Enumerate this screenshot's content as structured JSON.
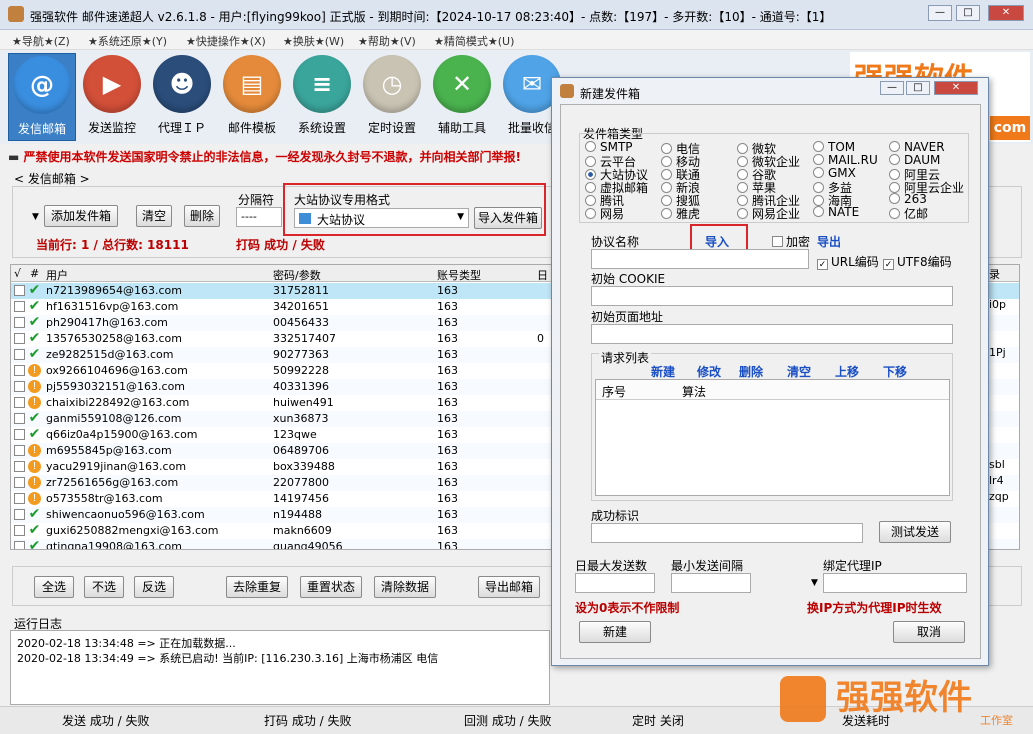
{
  "window": {
    "title": "强强软件 邮件速递超人 v2.6.1.8 - 用户:[flying99koo] 正式版 - 到期时间:【2024-10-17 08:23:40】- 点数:【197】- 多开数:【10】- 通道号:【1】"
  },
  "menu": [
    "★导航★(Z)",
    "★系统还原★(Y)",
    "★快捷操作★(X)",
    "★换肤★(W)",
    "★帮助★(V)",
    "★精简模式★(U)"
  ],
  "toolbar": [
    {
      "label": "发信邮箱",
      "icon": "at-icon",
      "color": "#3a8ee0"
    },
    {
      "label": "发送监控",
      "icon": "play-icon",
      "color": "#d24f38"
    },
    {
      "label": "代理ＩＰ",
      "icon": "user-icon",
      "color": "#2a4d7a"
    },
    {
      "label": "邮件模板",
      "icon": "doc-icon",
      "color": "#e48a3a"
    },
    {
      "label": "系统设置",
      "icon": "sliders-icon",
      "color": "#3aa59b"
    },
    {
      "label": "定时设置",
      "icon": "clock-icon",
      "color": "#c9c3b3"
    },
    {
      "label": "辅助工具",
      "icon": "wrench-icon",
      "color": "#4ab34e"
    },
    {
      "label": "批量收信",
      "icon": "mail-icon",
      "color": "#4fa3e6"
    }
  ],
  "brand": {
    "text": "强强软件",
    "sub": "工作室",
    "domain": "com"
  },
  "warning": "严禁使用本软件发送国家明令禁止的非法信息，一经发现永久封号不退款，并向相关部门举报!",
  "section": "< 发信邮箱 >",
  "controls": {
    "add": "添加发件箱",
    "clear": "清空",
    "delete": "删除",
    "separator_label": "分隔符",
    "separator_value": "----",
    "protocol_title": "大站协议专用格式",
    "protocol_value": "大站协议",
    "import": "导入发件箱",
    "current": "当前行: 1 / 总行数: 18111",
    "captcha": "打码 成功 / 失败"
  },
  "grid": {
    "headers": [
      "√",
      "#",
      "用户",
      "密码/参数",
      "账号类型",
      "日"
    ],
    "rows": [
      {
        "s": "ok",
        "user": "n7213989654@163.com",
        "pwd": "31752811",
        "type": "163",
        "d": ""
      },
      {
        "s": "ok",
        "user": "hf1631516vp@163.com",
        "pwd": "34201651",
        "type": "163",
        "d": ""
      },
      {
        "s": "ok",
        "user": "ph290417h@163.com",
        "pwd": "00456433",
        "type": "163",
        "d": ""
      },
      {
        "s": "ok",
        "user": "13576530258@163.com",
        "pwd": "332517407",
        "type": "163",
        "d": "0"
      },
      {
        "s": "ok",
        "user": "ze9282515d@163.com",
        "pwd": "90277363",
        "type": "163",
        "d": ""
      },
      {
        "s": "wa",
        "user": "ox9266104696@163.com",
        "pwd": "50992228",
        "type": "163",
        "d": ""
      },
      {
        "s": "wa",
        "user": "pj5593032151@163.com",
        "pwd": "40331396",
        "type": "163",
        "d": ""
      },
      {
        "s": "wa",
        "user": "chaixibi228492@163.com",
        "pwd": "huiwen491",
        "type": "163",
        "d": ""
      },
      {
        "s": "ok",
        "user": "ganmi559108@126.com",
        "pwd": "xun36873",
        "type": "163",
        "d": ""
      },
      {
        "s": "ok",
        "user": "q66iz0a4p15900@163.com",
        "pwd": "123qwe",
        "type": "163",
        "d": ""
      },
      {
        "s": "wa",
        "user": "m6955845p@163.com",
        "pwd": "06489706",
        "type": "163",
        "d": ""
      },
      {
        "s": "wa",
        "user": "yacu2919jinan@163.com",
        "pwd": "box339488",
        "type": "163",
        "d": ""
      },
      {
        "s": "wa",
        "user": "zr72561656g@163.com",
        "pwd": "22077800",
        "type": "163",
        "d": ""
      },
      {
        "s": "wa",
        "user": "o573558tr@163.com",
        "pwd": "14197456",
        "type": "163",
        "d": ""
      },
      {
        "s": "ok",
        "user": "shiwencaonuo596@163.com",
        "pwd": "n194488",
        "type": "163",
        "d": ""
      },
      {
        "s": "ok",
        "user": "guxi6250882mengxi@163.com",
        "pwd": "makn6609",
        "type": "163",
        "d": ""
      },
      {
        "s": "ok",
        "user": "qtingna19908@163.com",
        "pwd": "quang49056",
        "type": "163",
        "d": ""
      }
    ],
    "right_edge": [
      "录",
      "",
      "i0p",
      "",
      "",
      "1Pj",
      "",
      "",
      "",
      "",
      "",
      "",
      "sbl",
      "lr4",
      "zqp",
      ""
    ]
  },
  "bottom_buttons": [
    "全选",
    "不选",
    "反选",
    "去除重复",
    "重置状态",
    "清除数据",
    "导出邮箱"
  ],
  "log": {
    "title": "运行日志",
    "lines": [
      "2020-02-18 13:34:48 => 正在加载数据...",
      "2020-02-18 13:34:49 => 系统已启动! 当前IP: [116.230.3.16] 上海市杨浦区        电信"
    ]
  },
  "status": [
    "发送 成功 / 失败",
    "打码 成功 / 失败",
    "回测 成功 / 失败",
    "定时 关闭",
    "发送耗时"
  ],
  "dialog": {
    "title": "新建发件箱",
    "type_label": "发件箱类型",
    "types": [
      [
        "SMTP",
        "电信",
        "微软",
        "TOM",
        "NAVER"
      ],
      [
        "云平台",
        "移动",
        "微软企业",
        "MAIL.RU",
        "DAUM"
      ],
      [
        "大站协议",
        "联通",
        "谷歌",
        "GMX",
        "阿里云"
      ],
      [
        "虚拟邮箱",
        "新浪",
        "苹果",
        "多益",
        "阿里云企业"
      ],
      [
        "腾讯",
        "搜狐",
        "腾讯企业",
        "海南",
        "263"
      ],
      [
        "网易",
        "雅虎",
        "网易企业",
        "NATE",
        "亿邮"
      ]
    ],
    "selected_type": "大站协议",
    "proto_name": "协议名称",
    "import": "导入",
    "encrypt": "加密",
    "export": "导出",
    "url_enc": "URL编码",
    "utf8_enc": "UTF8编码",
    "cookie": "初始 COOKIE",
    "init_url": "初始页面地址",
    "req_list": "请求列表",
    "req_actions": [
      "新建",
      "修改",
      "删除",
      "清空",
      "上移",
      "下移"
    ],
    "req_cols": [
      "序号",
      "算法"
    ],
    "success": "成功标识",
    "test": "测试发送",
    "daily_max": "日最大发送数",
    "min_interval": "最小发送间隔",
    "bind_proxy": "绑定代理IP",
    "note_zero": "设为0表示不作限制",
    "note_proxy": "换IP方式为代理IP时生效",
    "create": "新建",
    "cancel": "取消"
  }
}
